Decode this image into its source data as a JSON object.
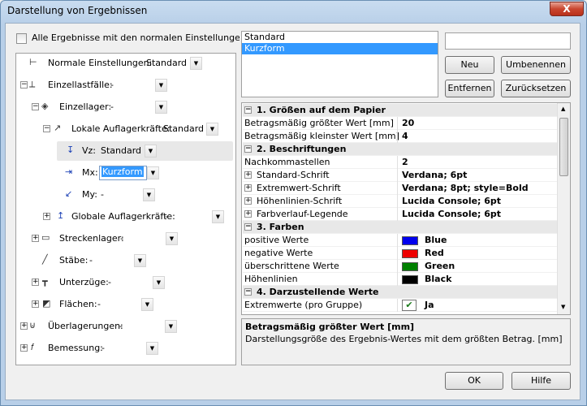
{
  "window": {
    "title": "Darstellung von Ergebnissen",
    "close": "X"
  },
  "top_checkbox": {
    "label": "Alle Ergebnisse mit den normalen Einstellungen darstellen",
    "checked": false
  },
  "style_list": {
    "items": [
      "Standard",
      "Kurzform"
    ],
    "selected": 1
  },
  "name_input": {
    "value": ""
  },
  "buttons": {
    "new": "Neu",
    "rename": "Umbenennen",
    "delete": "Entfernen",
    "reset": "Zurücksetzen",
    "ok": "OK",
    "help": "Hilfe"
  },
  "tree": [
    {
      "label": "Normale Einstellungen:",
      "value": "Standard",
      "icon": "line-icon",
      "expander": ""
    },
    {
      "label": "Einzellastfälle:",
      "value": "-",
      "icon": "load-case-icon",
      "expander": "−"
    },
    {
      "label": "Einzellager:",
      "value": "-",
      "icon": "support-icon",
      "expander": "−"
    },
    {
      "label": "Lokale Auflagerkräfte:",
      "value": "Standard",
      "icon": "force-arrow-icon",
      "expander": "−"
    },
    {
      "label": "Vz:",
      "value": "Standard",
      "icon": "vz-arrow-icon",
      "expander": ""
    },
    {
      "label": "Mx:",
      "value": "Kurzform",
      "icon": "mx-arrow-icon",
      "expander": ""
    },
    {
      "label": "My:",
      "value": "-",
      "icon": "my-arrow-icon",
      "expander": ""
    },
    {
      "label": "Globale Auflagerkräfte:",
      "value": "-",
      "icon": "global-force-icon",
      "expander": "+"
    },
    {
      "label": "Streckenlager:",
      "value": "-",
      "icon": "line-support-icon",
      "expander": "+"
    },
    {
      "label": "Stäbe:",
      "value": "-",
      "icon": "beam-icon",
      "expander": ""
    },
    {
      "label": "Unterzüge:",
      "value": "-",
      "icon": "girder-icon",
      "expander": "+"
    },
    {
      "label": "Flächen:",
      "value": "-",
      "icon": "surface-icon",
      "expander": "+"
    },
    {
      "label": "Überlagerungen:",
      "value": "-",
      "icon": "superposition-icon",
      "expander": "+"
    },
    {
      "label": "Bemessung:",
      "value": "-",
      "icon": "fx-icon",
      "expander": "+"
    }
  ],
  "grid": [
    {
      "type": "cat",
      "key": "1. Größen auf dem Papier",
      "exp": "−"
    },
    {
      "type": "row",
      "key": "Betragsmäßig größter Wert [mm]",
      "val": "20"
    },
    {
      "type": "row",
      "key": "Betragsmäßig kleinster Wert [mm]",
      "val": "4"
    },
    {
      "type": "cat",
      "key": "2. Beschriftungen",
      "exp": "−"
    },
    {
      "type": "row",
      "key": "Nachkommastellen",
      "val": "2"
    },
    {
      "type": "row",
      "key": "Standard-Schrift",
      "val": "Verdana; 6pt",
      "exp": "+"
    },
    {
      "type": "row",
      "key": "Extremwert-Schrift",
      "val": "Verdana; 8pt; style=Bold",
      "exp": "+"
    },
    {
      "type": "row",
      "key": "Höhenlinien-Schrift",
      "val": "Lucida Console; 6pt",
      "exp": "+"
    },
    {
      "type": "row",
      "key": "Farbverlauf-Legende",
      "val": "Lucida Console; 6pt",
      "exp": "+"
    },
    {
      "type": "cat",
      "key": "3. Farben",
      "exp": "−"
    },
    {
      "type": "color",
      "key": "positive Werte",
      "val": "Blue",
      "color": "#0000ee"
    },
    {
      "type": "color",
      "key": "negative Werte",
      "val": "Red",
      "color": "#ee0000"
    },
    {
      "type": "color",
      "key": "überschrittene Werte",
      "val": "Green",
      "color": "#008000"
    },
    {
      "type": "color",
      "key": "Höhenlinien",
      "val": "Black",
      "color": "#000000"
    },
    {
      "type": "cat",
      "key": "4. Darzustellende Werte",
      "exp": "−"
    },
    {
      "type": "check",
      "key": "Extremwerte (pro Gruppe)",
      "val": "Ja"
    }
  ],
  "description": {
    "title": "Betragsmäßig größter Wert [mm]",
    "text": "Darstellungsgröße des Ergebnis-Wertes mit dem größten Betrag. [mm]"
  }
}
